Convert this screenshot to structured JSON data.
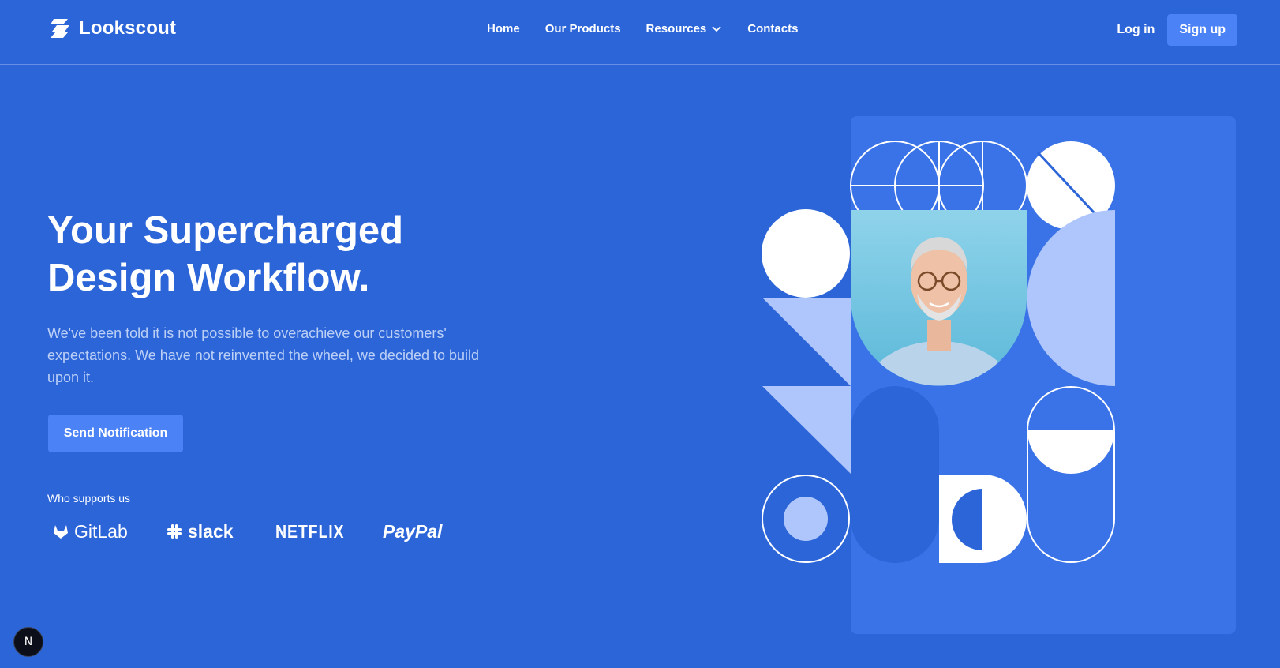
{
  "brand": {
    "name": "Lookscout",
    "logo_icon": "stacked-stripes-icon"
  },
  "nav": {
    "items": [
      {
        "label": "Home"
      },
      {
        "label": "Our Products"
      },
      {
        "label": "Resources",
        "icon": "chevron-down-icon"
      },
      {
        "label": "Contacts"
      }
    ],
    "login_label": "Log in",
    "signup_label": "Sign up"
  },
  "hero": {
    "title_line1": "Your Supercharged",
    "title_line2": "Design Workflow.",
    "description": "We've been told it is not possible to overachieve our customers' expectations. We have not reinvented the wheel, we decided to build upon it.",
    "cta_label": "Send Notification"
  },
  "supporters": {
    "label": "Who supports us",
    "logos": [
      {
        "name": "GitLab",
        "icon": "gitlab-fox-icon"
      },
      {
        "name": "slack",
        "icon": "slack-hash-icon"
      },
      {
        "name": "NETFLIX"
      },
      {
        "name": "PayPal"
      }
    ]
  },
  "badge": {
    "label": "N"
  },
  "colors": {
    "background": "#2c65d8",
    "accent": "#4b82f5",
    "panel": "#3a73e8",
    "light_shape": "#aec6fb",
    "photo_bg": "#7cc8e3"
  }
}
